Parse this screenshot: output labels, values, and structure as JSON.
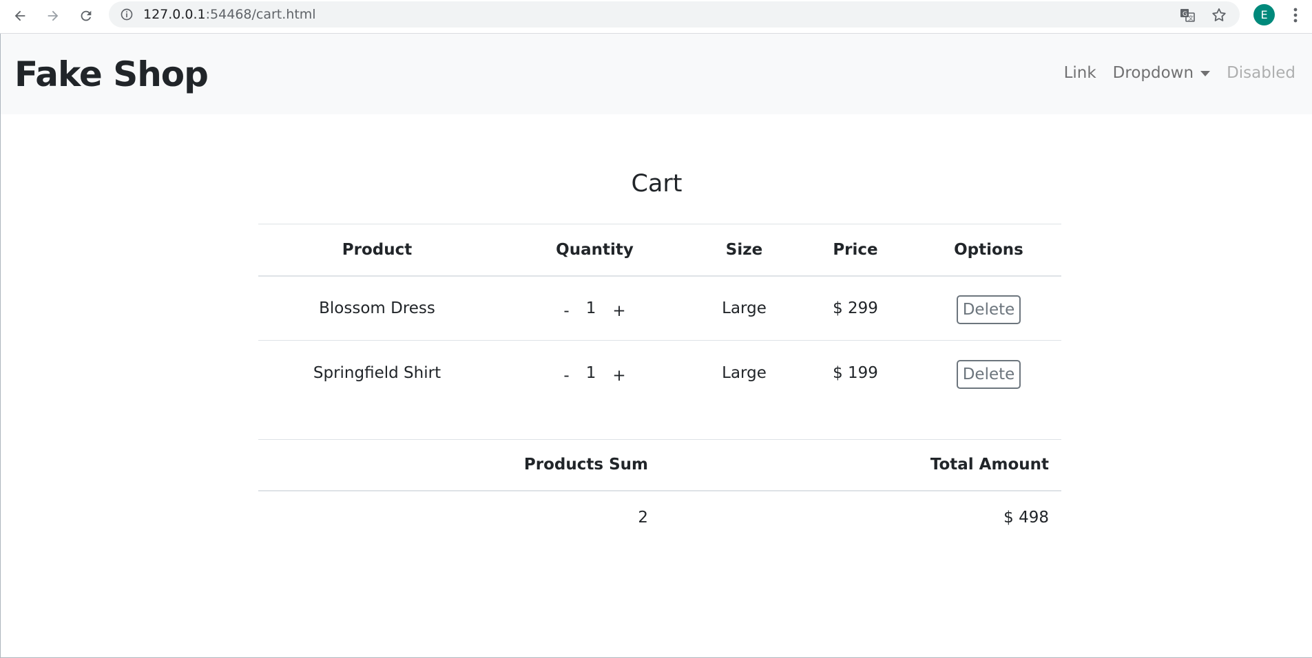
{
  "browser": {
    "url_host": "127.0.0.1",
    "url_rest": ":54468/cart.html",
    "profile_initial": "E",
    "profile_color": "#00897b"
  },
  "navbar": {
    "brand": "Fake Shop",
    "links": [
      {
        "label": "Link"
      },
      {
        "label": "Dropdown"
      },
      {
        "label": "Disabled"
      }
    ]
  },
  "cart": {
    "title": "Cart",
    "headers": [
      "Product",
      "Quantity",
      "Size",
      "Price",
      "Options"
    ],
    "items": [
      {
        "product": "Blossom Dress",
        "minus": "-",
        "quantity": "1",
        "plus": "+",
        "size": "Large",
        "price": "$ 299",
        "action": "Delete"
      },
      {
        "product": "Springfield Shirt",
        "minus": "-",
        "quantity": "1",
        "plus": "+",
        "size": "Large",
        "price": "$ 199",
        "action": "Delete"
      }
    ],
    "summary": {
      "sum_label": "Products Sum",
      "total_label": "Total Amount",
      "sum_value": "2",
      "total_value": "$ 498"
    }
  }
}
